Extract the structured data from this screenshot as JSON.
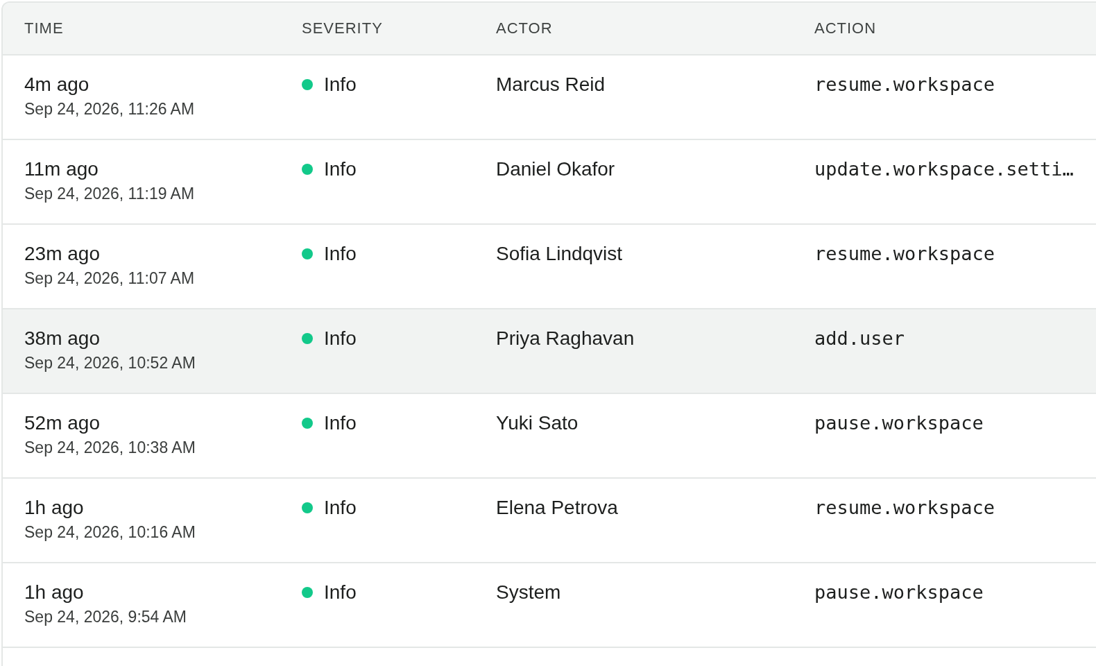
{
  "table": {
    "columns": [
      "TIME",
      "SEVERITY",
      "ACTOR",
      "ACTION"
    ],
    "rows": [
      {
        "relative": "4m ago",
        "timestamp": "Sep 24, 2026, 11:26 AM",
        "severity": "Info",
        "color": "#12c98a",
        "actor": "Marcus Reid",
        "action": "resume.workspace",
        "selected": false
      },
      {
        "relative": "11m ago",
        "timestamp": "Sep 24, 2026, 11:19 AM",
        "severity": "Info",
        "color": "#12c98a",
        "actor": "Daniel Okafor",
        "action": "update.workspace.setti…",
        "selected": false
      },
      {
        "relative": "23m ago",
        "timestamp": "Sep 24, 2026, 11:07 AM",
        "severity": "Info",
        "color": "#12c98a",
        "actor": "Sofia Lindqvist",
        "action": "resume.workspace",
        "selected": false
      },
      {
        "relative": "38m ago",
        "timestamp": "Sep 24, 2026, 10:52 AM",
        "severity": "Info",
        "color": "#12c98a",
        "actor": "Priya Raghavan",
        "action": "add.user",
        "selected": true
      },
      {
        "relative": "52m ago",
        "timestamp": "Sep 24, 2026, 10:38 AM",
        "severity": "Info",
        "color": "#12c98a",
        "actor": "Yuki Sato",
        "action": "pause.workspace",
        "selected": false
      },
      {
        "relative": "1h ago",
        "timestamp": "Sep 24, 2026, 10:16 AM",
        "severity": "Info",
        "color": "#12c98a",
        "actor": "Elena Petrova",
        "action": "resume.workspace",
        "selected": false
      },
      {
        "relative": "1h ago",
        "timestamp": "Sep 24, 2026, 9:54 AM",
        "severity": "Info",
        "color": "#12c98a",
        "actor": "System",
        "action": "pause.workspace",
        "selected": false
      }
    ]
  }
}
